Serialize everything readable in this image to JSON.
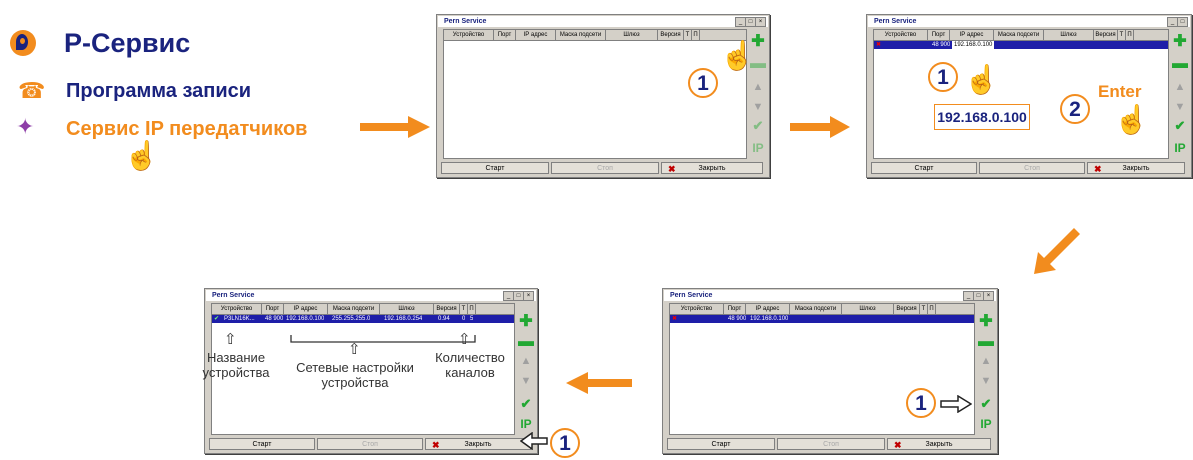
{
  "brand": {
    "title": "Р-Сервис",
    "logo_icon": "p-logo-icon",
    "color_primary": "#1a237e",
    "color_accent": "#f28c1e"
  },
  "menu": [
    {
      "label": "Программа записи",
      "icon": "phone-icon"
    },
    {
      "label": "Сервис IP передатчиков",
      "icon": "butterfly-icon"
    }
  ],
  "window": {
    "title": "Pern Service",
    "controls": [
      "_",
      "□",
      "×"
    ],
    "columns": [
      "Устройство",
      "Порт",
      "IP адрес",
      "Маска подсети",
      "Шлюз",
      "Версия",
      "Т",
      "П"
    ],
    "buttons": {
      "start": "Старт",
      "stop": "Стоп",
      "close": "Закрыть"
    },
    "side_icons": [
      "plus-icon",
      "minus-icon",
      "arrow-up-icon",
      "arrow-down-icon",
      "check-icon",
      "ip-icon"
    ],
    "side_ip_label": "IP"
  },
  "steps": {
    "step1_num": "1",
    "step2_num": "1",
    "step2_num_b": "2",
    "step2_ip": "192.168.0.100",
    "step2_enter": "Enter",
    "step3_num": "1",
    "step4_num": "1"
  },
  "rows": {
    "win2": {
      "port": "48 900",
      "ip": "192.168.0.100"
    },
    "win3": {
      "port": "48 900",
      "ip": "192.168.0.100"
    },
    "win4": {
      "device": "P3LN16K...",
      "port": "48 900",
      "ip": "192.168.0.100",
      "mask": "255.255.255.0",
      "gateway": "192.168.0.254",
      "version": "0.94",
      "t": "0",
      "p": "5"
    }
  },
  "annotations": {
    "device_name": "Название устройства",
    "network": "Сетевые настройки устройства",
    "channels": "Количество каналов"
  }
}
